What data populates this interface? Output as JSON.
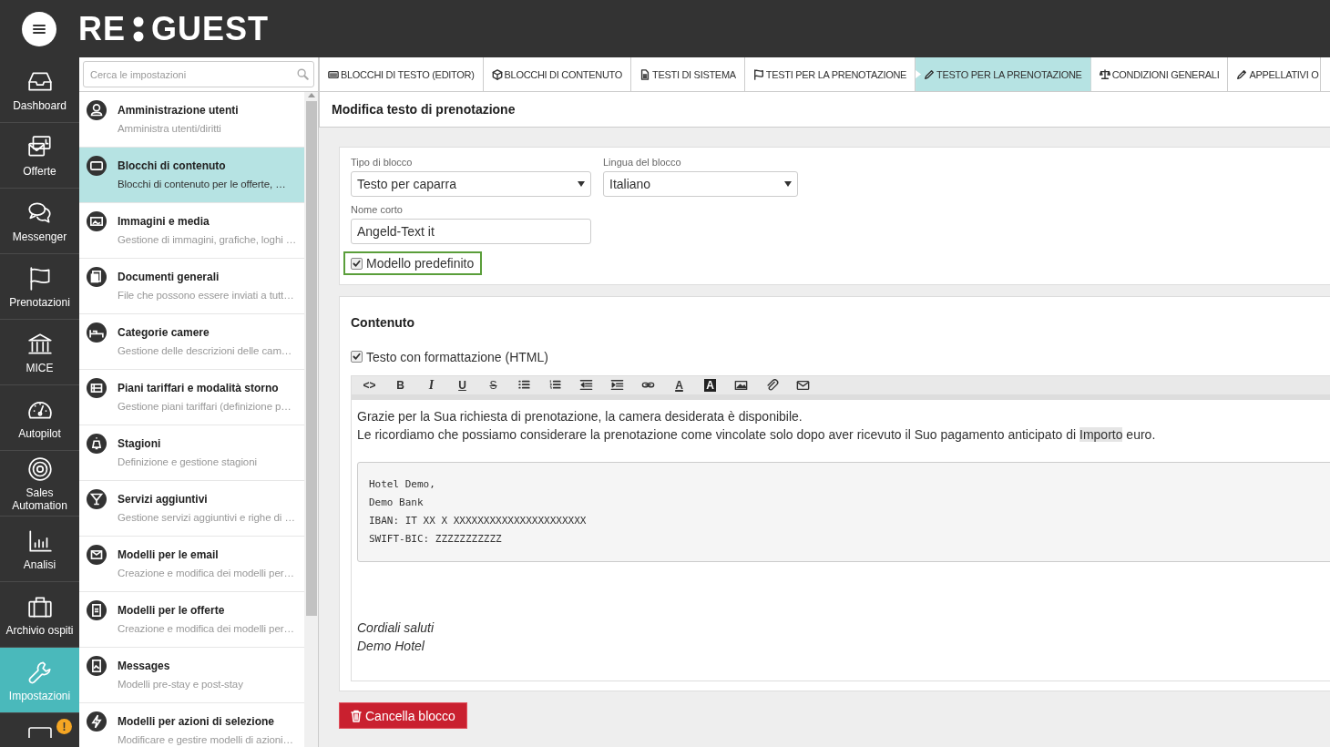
{
  "topbar": {
    "logo_left": "RE",
    "logo_right": "GUEST"
  },
  "nav": [
    {
      "label": "Dashboard",
      "selected": false
    },
    {
      "label": "Offerte",
      "selected": false
    },
    {
      "label": "Messenger",
      "selected": false
    },
    {
      "label": "Prenotazioni",
      "selected": false
    },
    {
      "label": "MICE",
      "selected": false
    },
    {
      "label": "Autopilot",
      "selected": false
    },
    {
      "label": "Sales Automation",
      "selected": false
    },
    {
      "label": "Analisi",
      "selected": false
    },
    {
      "label": "Archivio ospiti",
      "selected": false
    },
    {
      "label": "Impostazioni",
      "selected": true
    }
  ],
  "nav_partial": {
    "badge": "!"
  },
  "settings_search": {
    "placeholder": "Cerca le impostazioni"
  },
  "settings_items": [
    {
      "title": "Amministrazione utenti",
      "subtitle": "Amministra utenti/diritti",
      "selected": false
    },
    {
      "title": "Blocchi di contenuto",
      "subtitle": "Blocchi di contenuto per le offerte, …",
      "selected": true
    },
    {
      "title": "Immagini e media",
      "subtitle": "Gestione di immagini, grafiche, loghi …",
      "selected": false
    },
    {
      "title": "Documenti generali",
      "subtitle": "File che possono essere inviati a tutt…",
      "selected": false
    },
    {
      "title": "Categorie camere",
      "subtitle": "Gestione delle descrizioni delle cam…",
      "selected": false
    },
    {
      "title": "Piani tariffari e modalità storno",
      "subtitle": "Gestione piani tariffari (definizione p…",
      "selected": false
    },
    {
      "title": "Stagioni",
      "subtitle": "Definizione e gestione stagioni",
      "selected": false
    },
    {
      "title": "Servizi aggiuntivi",
      "subtitle": "Gestione servizi aggiuntivi e righe di …",
      "selected": false
    },
    {
      "title": "Modelli per le email",
      "subtitle": "Creazione e modifica dei modelli per…",
      "selected": false
    },
    {
      "title": "Modelli per le offerte",
      "subtitle": "Creazione e modifica dei modelli per…",
      "selected": false
    },
    {
      "title": "Messages",
      "subtitle": "Modelli pre-stay e post-stay",
      "selected": false
    },
    {
      "title": "Modelli per azioni di selezione",
      "subtitle": "Modificare e gestire modelli di azioni…",
      "selected": false
    }
  ],
  "tabs": [
    {
      "label": "BLOCCHI DI TESTO (EDITOR)",
      "selected": false
    },
    {
      "label": "BLOCCHI DI CONTENUTO",
      "selected": false
    },
    {
      "label": "TESTI DI SISTEMA",
      "selected": false
    },
    {
      "label": "TESTI PER LA PRENOTAZIONE",
      "selected": false
    },
    {
      "label": "TESTO PER LA PRENOTAZIONE",
      "selected": true
    },
    {
      "label": "CONDIZIONI GENERALI",
      "selected": false
    },
    {
      "label": "APPELLATIVI O",
      "selected": false
    }
  ],
  "page_title": "Modifica testo di prenotazione",
  "form": {
    "block_type": {
      "label": "Tipo di blocco",
      "value": "Testo per caparra"
    },
    "block_language": {
      "label": "Lingua del blocco",
      "value": "Italiano"
    },
    "short_name": {
      "label": "Nome corto",
      "value": "Angeld-Text it"
    },
    "default_template": {
      "label": "Modello predefinito",
      "checked": true
    }
  },
  "content": {
    "title": "Contenuto",
    "html_format": {
      "label": "Testo con formattazione (HTML)",
      "checked": true
    },
    "toolbar": [
      {
        "kind": "code",
        "label": "<>"
      },
      {
        "kind": "bold",
        "label": "B"
      },
      {
        "kind": "italic",
        "label": "I"
      },
      {
        "kind": "underline",
        "label": "U"
      },
      {
        "kind": "strike",
        "label": "S"
      },
      {
        "kind": "bullets"
      },
      {
        "kind": "numbers"
      },
      {
        "kind": "outdent"
      },
      {
        "kind": "indent"
      },
      {
        "kind": "link"
      },
      {
        "kind": "color",
        "label": "A"
      },
      {
        "kind": "highlight",
        "label": "A"
      },
      {
        "kind": "image"
      },
      {
        "kind": "attach"
      },
      {
        "kind": "mail"
      }
    ],
    "intro": "Grazie per la Sua richiesta di prenotazione, la camera desiderata è disponibile.",
    "reminder": [
      {
        "kind": "plain",
        "text": "Le ricordiamo che possiamo considerare la prenotazione come vincolate solo dopo aver ricevuto il Suo pagamento anticipato di "
      },
      {
        "kind": "placeholder",
        "text": "Importo"
      },
      {
        "kind": "plain",
        "text": " euro."
      }
    ],
    "code_lines": [
      "Hotel Demo,",
      "Demo Bank",
      "IBAN: IT XX X XXXXXXXXXXXXXXXXXXXXXX",
      "SWIFT-BIC: ZZZZZZZZZZZ"
    ],
    "closing": [
      "Cordiali saluti",
      "Demo Hotel"
    ]
  },
  "delete_button": "Cancella blocco"
}
